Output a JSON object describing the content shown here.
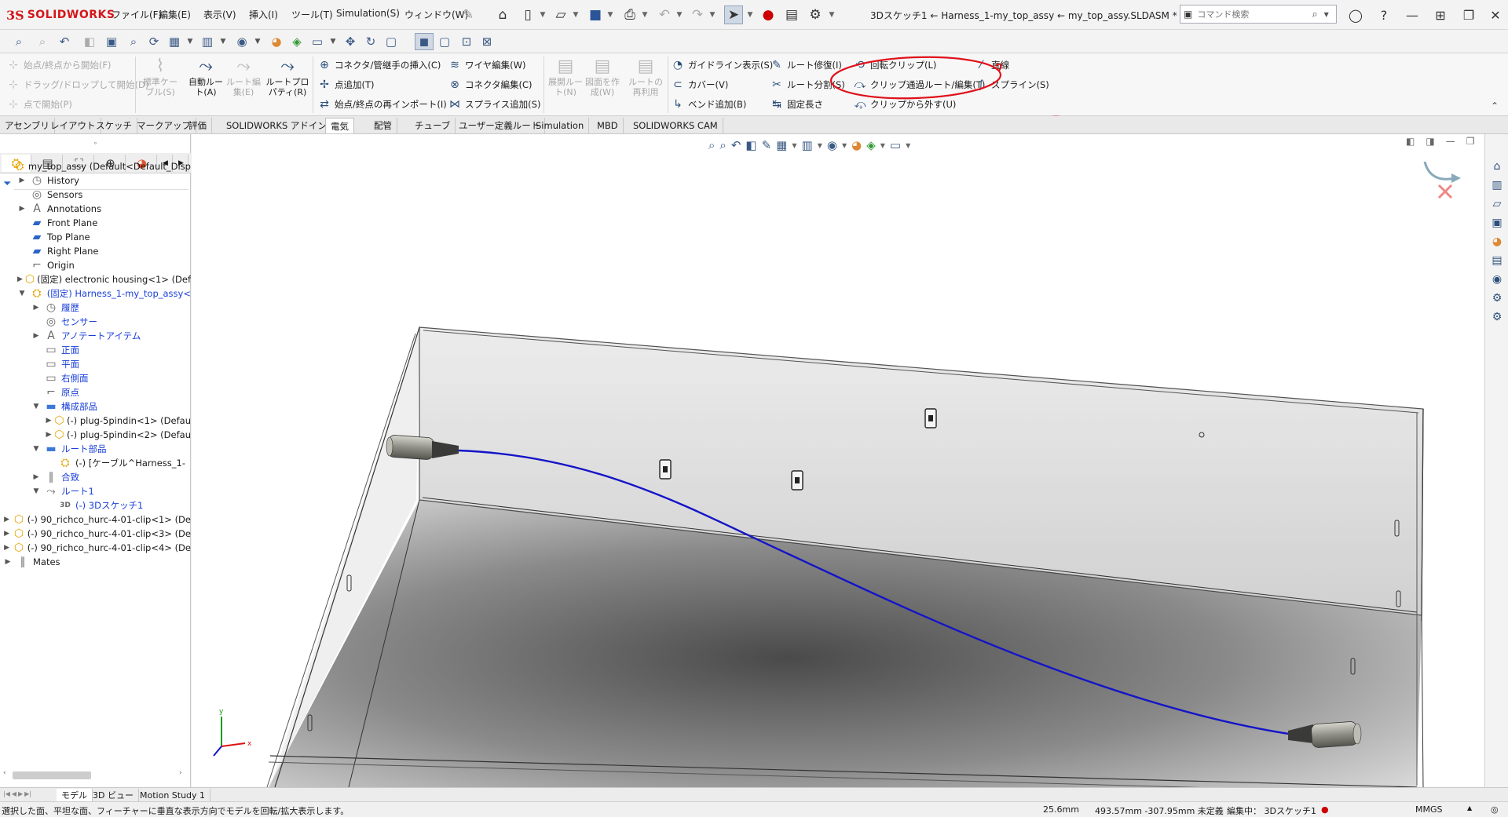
{
  "app": {
    "brand_ds": "3S",
    "brand_name": "SOLIDWORKS",
    "menus": [
      "ファイル(F)",
      "編集(E)",
      "表示(V)",
      "挿入(I)",
      "ツール(T)",
      "Simulation(S)",
      "ウィンドウ(W)"
    ],
    "document_title": "3Dスケッチ1 ← Harness_1-my_top_assy ← my_top_assy.SLDASM *",
    "search_placeholder": "コマンド検索"
  },
  "ribbon": {
    "col1": [
      {
        "label": "始点/終点から開始(F)",
        "enabled": false
      },
      {
        "label": "ドラッグ/ドロップして開始(D)",
        "enabled": false
      },
      {
        "label": "点で開始(P)",
        "enabled": false
      }
    ],
    "big1": [
      {
        "label": "標準ケーブル(S)",
        "enabled": false
      },
      {
        "label": "自動ルート(A)",
        "enabled": true
      },
      {
        "label": "ルート編集(E)",
        "enabled": false
      },
      {
        "label": "ルートプロパティ(R)",
        "enabled": true
      }
    ],
    "col2": [
      {
        "label": "コネクタ/管継手の挿入(C)"
      },
      {
        "label": "点追加(T)"
      },
      {
        "label": "始点/終点の再インポート(I)"
      }
    ],
    "col3": [
      {
        "label": "ワイヤ編集(W)"
      },
      {
        "label": "コネクタ編集(C)"
      },
      {
        "label": "スプライス追加(S)"
      }
    ],
    "big2": [
      {
        "label": "展開ルート(N)"
      },
      {
        "label": "図面を作成(W)"
      },
      {
        "label": "ルートの再利用"
      }
    ],
    "col4": [
      {
        "label": "ガイドライン表示(S)"
      },
      {
        "label": "カバー(V)"
      },
      {
        "label": "ベンド追加(B)"
      }
    ],
    "col5": [
      {
        "label": "ルート修復(I)"
      },
      {
        "label": "ルート分割(S)"
      },
      {
        "label": "固定長さ"
      }
    ],
    "col6": [
      {
        "label": "回転クリップ(L)"
      },
      {
        "label": "クリップ通過ルート/編集(T)"
      },
      {
        "label": "クリップから外す(U)"
      }
    ],
    "col7": [
      {
        "label": "直線"
      },
      {
        "label": "スプライン(S)"
      }
    ]
  },
  "tabs": [
    {
      "label": "アセンブリ",
      "active": false
    },
    {
      "label": "レイアウト",
      "active": false
    },
    {
      "label": "スケッチ",
      "active": false
    },
    {
      "label": "マークアップ",
      "active": false
    },
    {
      "label": "評価",
      "active": false
    },
    {
      "label": "SOLIDWORKS アドイン",
      "active": false
    },
    {
      "label": "電気",
      "active": true
    },
    {
      "label": "配管",
      "active": false
    },
    {
      "label": "チューブ",
      "active": false
    },
    {
      "label": "ユーザー定義ルート",
      "active": false
    },
    {
      "label": "Simulation",
      "active": false
    },
    {
      "label": "MBD",
      "active": false
    },
    {
      "label": "SOLIDWORKS CAM",
      "active": false
    }
  ],
  "tree": [
    {
      "label": "my_top_assy  (Default<Default_Disp",
      "indent": 0,
      "exp": "",
      "icon": "assembly",
      "blue": false
    },
    {
      "label": "History",
      "indent": 1,
      "exp": "▶",
      "icon": "history",
      "blue": false
    },
    {
      "label": "Sensors",
      "indent": 1,
      "exp": "",
      "icon": "sensor",
      "blue": false
    },
    {
      "label": "Annotations",
      "indent": 1,
      "exp": "▶",
      "icon": "annotation",
      "blue": false
    },
    {
      "label": "Front Plane",
      "indent": 1,
      "exp": "",
      "icon": "plane",
      "blue": false
    },
    {
      "label": "Top Plane",
      "indent": 1,
      "exp": "",
      "icon": "plane",
      "blue": false
    },
    {
      "label": "Right Plane",
      "indent": 1,
      "exp": "",
      "icon": "plane",
      "blue": false
    },
    {
      "label": "Origin",
      "indent": 1,
      "exp": "",
      "icon": "origin",
      "blue": false
    },
    {
      "label": "(固定) electronic housing<1> (Defau",
      "indent": 1,
      "exp": "▶",
      "icon": "part",
      "blue": false
    },
    {
      "label": "(固定) Harness_1-my_top_assy<",
      "indent": 1,
      "exp": "▼",
      "icon": "assembly",
      "blue": true
    },
    {
      "label": "履歴",
      "indent": 2,
      "exp": "▶",
      "icon": "history",
      "blue": true
    },
    {
      "label": "センサー",
      "indent": 2,
      "exp": "",
      "icon": "sensor",
      "blue": true
    },
    {
      "label": "アノテートアイテム",
      "indent": 2,
      "exp": "▶",
      "icon": "annotation",
      "blue": true
    },
    {
      "label": "正面",
      "indent": 2,
      "exp": "",
      "icon": "plane-outline",
      "blue": true
    },
    {
      "label": "平面",
      "indent": 2,
      "exp": "",
      "icon": "plane-outline",
      "blue": true
    },
    {
      "label": "右側面",
      "indent": 2,
      "exp": "",
      "icon": "plane-outline",
      "blue": true
    },
    {
      "label": "原点",
      "indent": 2,
      "exp": "",
      "icon": "origin",
      "blue": true
    },
    {
      "label": "構成部品",
      "indent": 2,
      "exp": "▼",
      "icon": "folder",
      "blue": true
    },
    {
      "label": "(-) plug-5pindin<1> (Defau",
      "indent": 3,
      "exp": "▶",
      "icon": "part",
      "blue": false
    },
    {
      "label": "(-) plug-5pindin<2> (Defau",
      "indent": 3,
      "exp": "▶",
      "icon": "part",
      "blue": false
    },
    {
      "label": "ルート部品",
      "indent": 2,
      "exp": "▼",
      "icon": "folder",
      "blue": true
    },
    {
      "label": "(-) [ケーブル^Harness_1-",
      "indent": 3,
      "exp": "",
      "icon": "assembly",
      "blue": false
    },
    {
      "label": "合致",
      "indent": 2,
      "exp": "▶",
      "icon": "mates",
      "blue": true
    },
    {
      "label": "ルート1",
      "indent": 2,
      "exp": "▼",
      "icon": "route",
      "blue": true
    },
    {
      "label": "(-) 3Dスケッチ1",
      "indent": 3,
      "exp": "",
      "icon": "sketch3d",
      "blue": true
    },
    {
      "label": "(-) 90_richco_hurc-4-01-clip<1> (De",
      "indent": 0,
      "exp": "▶",
      "icon": "part",
      "blue": false
    },
    {
      "label": "(-) 90_richco_hurc-4-01-clip<3> (De",
      "indent": 0,
      "exp": "▶",
      "icon": "part",
      "blue": false
    },
    {
      "label": "(-) 90_richco_hurc-4-01-clip<4> (De",
      "indent": 0,
      "exp": "▶",
      "icon": "part",
      "blue": false
    },
    {
      "label": "Mates",
      "indent": 0,
      "exp": "▶",
      "icon": "mates",
      "blue": false
    }
  ],
  "bottom_tabs": [
    {
      "label": "モデル",
      "active": true
    },
    {
      "label": "3D ビュー",
      "active": false
    },
    {
      "label": "Motion Study 1",
      "active": false
    }
  ],
  "status": {
    "message": "選択した面、平坦な面、フィーチャーに垂直な表示方向でモデルを回転/拡大表示します。",
    "value1": "25.6mm",
    "coords": "493.57mm -307.95mm 未定義",
    "editing": "編集中： 3Dスケッチ1",
    "units": "MMGS"
  },
  "triad": {
    "x": "x",
    "y": "y"
  },
  "colors": {
    "route": "#1414c8",
    "annotation": "#e0101a",
    "brand": "#d4151a"
  }
}
